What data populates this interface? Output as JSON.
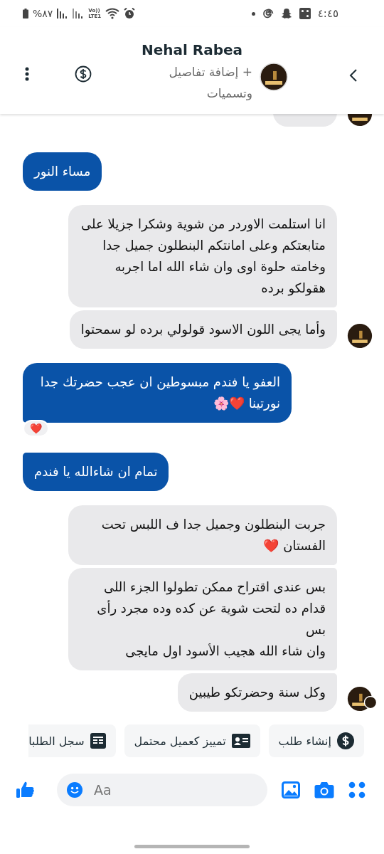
{
  "status_bar": {
    "battery": "%٨٧",
    "network": [
      "Vo))",
      "LTE1"
    ],
    "time": "٤:٤٥"
  },
  "header": {
    "name": "Nehal Rabea",
    "subtitle": "+ إضافة تفاصيل وتسميات"
  },
  "messages": [
    {
      "kind": "cut_off",
      "avatar": true
    },
    {
      "kind": "sent",
      "text": "مساء النور"
    },
    {
      "kind": "received",
      "text": "انا استلمت الاوردر من شوية وشكرا جزيلا على متابعتكم وعلى امانتكم البنطلون جميل جدا وخامته حلوة اوى وان شاء الله اما اجربه هقولكو برده",
      "avatar": false
    },
    {
      "kind": "received",
      "text": "وأما يجى اللون الاسود قولولي برده لو سمحتوا",
      "avatar": true
    },
    {
      "kind": "sent",
      "text": "العفو يا فندم مبسوطين ان عجب حضرتك جدا نورتينا ❤️🌸",
      "reaction": "❤️"
    },
    {
      "kind": "sent",
      "text": "تمام ان شاءالله يا فندم"
    },
    {
      "kind": "received",
      "text": "جربت البنطلون وجميل جدا ف اللبس تحت الفستان ❤️",
      "avatar": false
    },
    {
      "kind": "received",
      "text": "بس عندى اقتراح ممكن تطولوا الجزء اللى قدام ده لتحت شوية عن كده وده مجرد رأى بس\nوان شاء الله هجيب الأسود اول مايجى",
      "avatar": false
    },
    {
      "kind": "received",
      "text": "وكل سنة وحضرتكو طيبين",
      "avatar": true,
      "seen": true
    }
  ],
  "quick_actions": [
    {
      "kind": "order",
      "label": "إنشاء طلب"
    },
    {
      "kind": "lead",
      "label": "تمييز كعميل محتمل"
    },
    {
      "kind": "history",
      "label": "سجل الطلبا"
    }
  ],
  "composer": {
    "placeholder": "Aa"
  }
}
